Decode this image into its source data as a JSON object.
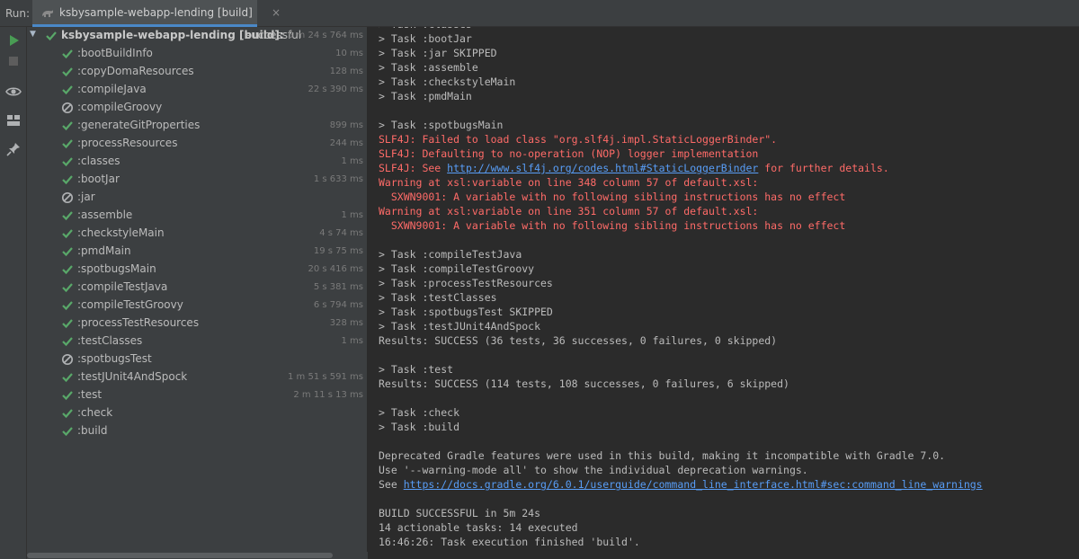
{
  "run_label": "Run:",
  "tab": {
    "title": "ksbysample-webapp-lending [build]",
    "close": "×"
  },
  "colors": {
    "success": "#59a869",
    "error": "#ff6b68",
    "link": "#589df6",
    "accent": "#4a88c7"
  },
  "tree": {
    "root": {
      "label": "ksbysample-webapp-lending [build]:",
      "status_text": "successful",
      "time": "5 m 24 s 764 ms"
    },
    "tasks": [
      {
        "label": ":bootBuildInfo",
        "time": "10 ms",
        "status": "success"
      },
      {
        "label": ":copyDomaResources",
        "time": "128 ms",
        "status": "success"
      },
      {
        "label": ":compileJava",
        "time": "22 s 390 ms",
        "status": "success"
      },
      {
        "label": ":compileGroovy",
        "time": "",
        "status": "skipped"
      },
      {
        "label": ":generateGitProperties",
        "time": "899 ms",
        "status": "success"
      },
      {
        "label": ":processResources",
        "time": "244 ms",
        "status": "success"
      },
      {
        "label": ":classes",
        "time": "1 ms",
        "status": "success"
      },
      {
        "label": ":bootJar",
        "time": "1 s 633 ms",
        "status": "success"
      },
      {
        "label": ":jar",
        "time": "",
        "status": "skipped"
      },
      {
        "label": ":assemble",
        "time": "1 ms",
        "status": "success"
      },
      {
        "label": ":checkstyleMain",
        "time": "4 s 74 ms",
        "status": "success"
      },
      {
        "label": ":pmdMain",
        "time": "19 s 75 ms",
        "status": "success"
      },
      {
        "label": ":spotbugsMain",
        "time": "20 s 416 ms",
        "status": "success"
      },
      {
        "label": ":compileTestJava",
        "time": "5 s 381 ms",
        "status": "success"
      },
      {
        "label": ":compileTestGroovy",
        "time": "6 s 794 ms",
        "status": "success"
      },
      {
        "label": ":processTestResources",
        "time": "328 ms",
        "status": "success"
      },
      {
        "label": ":testClasses",
        "time": "1 ms",
        "status": "success"
      },
      {
        "label": ":spotbugsTest",
        "time": "",
        "status": "skipped"
      },
      {
        "label": ":testJUnit4AndSpock",
        "time": "1 m 51 s 591 ms",
        "status": "success"
      },
      {
        "label": ":test",
        "time": "2 m 11 s 13 ms",
        "status": "success"
      },
      {
        "label": ":check",
        "time": "",
        "status": "success"
      },
      {
        "label": ":build",
        "time": "",
        "status": "success"
      }
    ]
  },
  "console": {
    "lines": [
      {
        "text": "> Task :classes",
        "type": "normal"
      },
      {
        "text": "> Task :bootJar",
        "type": "normal"
      },
      {
        "text": "> Task :jar SKIPPED",
        "type": "normal"
      },
      {
        "text": "> Task :assemble",
        "type": "normal"
      },
      {
        "text": "> Task :checkstyleMain",
        "type": "normal"
      },
      {
        "text": "> Task :pmdMain",
        "type": "normal"
      },
      {
        "text": "",
        "type": "normal"
      },
      {
        "text": "> Task :spotbugsMain",
        "type": "normal"
      },
      {
        "text": "SLF4J: Failed to load class \"org.slf4j.impl.StaticLoggerBinder\".",
        "type": "error"
      },
      {
        "text": "SLF4J: Defaulting to no-operation (NOP) logger implementation",
        "type": "error"
      },
      {
        "text": "SLF4J: See ",
        "type": "error",
        "link": "http://www.slf4j.org/codes.html#StaticLoggerBinder",
        "after": " for further details."
      },
      {
        "text": "Warning at xsl:variable on line 348 column 57 of default.xsl:",
        "type": "error"
      },
      {
        "text": "  SXWN9001: A variable with no following sibling instructions has no effect",
        "type": "error"
      },
      {
        "text": "Warning at xsl:variable on line 351 column 57 of default.xsl:",
        "type": "error"
      },
      {
        "text": "  SXWN9001: A variable with no following sibling instructions has no effect",
        "type": "error"
      },
      {
        "text": "",
        "type": "normal"
      },
      {
        "text": "> Task :compileTestJava",
        "type": "normal"
      },
      {
        "text": "> Task :compileTestGroovy",
        "type": "normal"
      },
      {
        "text": "> Task :processTestResources",
        "type": "normal"
      },
      {
        "text": "> Task :testClasses",
        "type": "normal"
      },
      {
        "text": "> Task :spotbugsTest SKIPPED",
        "type": "normal"
      },
      {
        "text": "> Task :testJUnit4AndSpock",
        "type": "normal"
      },
      {
        "text": "Results: SUCCESS (36 tests, 36 successes, 0 failures, 0 skipped)",
        "type": "normal"
      },
      {
        "text": "",
        "type": "normal"
      },
      {
        "text": "> Task :test",
        "type": "normal"
      },
      {
        "text": "Results: SUCCESS (114 tests, 108 successes, 0 failures, 6 skipped)",
        "type": "normal"
      },
      {
        "text": "",
        "type": "normal"
      },
      {
        "text": "> Task :check",
        "type": "normal"
      },
      {
        "text": "> Task :build",
        "type": "normal"
      },
      {
        "text": "",
        "type": "normal"
      },
      {
        "text": "Deprecated Gradle features were used in this build, making it incompatible with Gradle 7.0.",
        "type": "normal"
      },
      {
        "text": "Use '--warning-mode all' to show the individual deprecation warnings.",
        "type": "normal"
      },
      {
        "text": "See ",
        "type": "normal",
        "link": "https://docs.gradle.org/6.0.1/userguide/command_line_interface.html#sec:command_line_warnings",
        "after": ""
      },
      {
        "text": "",
        "type": "normal"
      },
      {
        "text": "BUILD SUCCESSFUL in 5m 24s",
        "type": "normal"
      },
      {
        "text": "14 actionable tasks: 14 executed",
        "type": "normal"
      },
      {
        "text": "16:46:26: Task execution finished 'build'.",
        "type": "normal"
      }
    ]
  }
}
